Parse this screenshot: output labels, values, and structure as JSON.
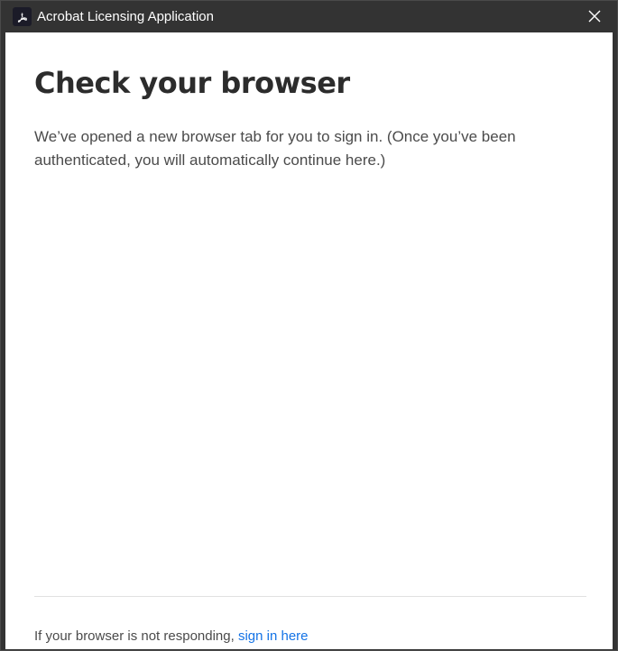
{
  "window": {
    "title": "Acrobat Licensing Application",
    "app_icon": "acrobat-logo-icon",
    "close_icon": "close-icon"
  },
  "main": {
    "heading": "Check your browser",
    "message": "We’ve opened a new browser tab for you to sign in. (Once you’ve been authenticated, you will automatically continue here.)"
  },
  "footer": {
    "prompt": "If your browser is not responding,",
    "link_label": "sign in here"
  },
  "colors": {
    "titlebar": "#333333",
    "link": "#1473e6",
    "heading": "#2c2c2c",
    "body_text": "#4b4b4b"
  }
}
